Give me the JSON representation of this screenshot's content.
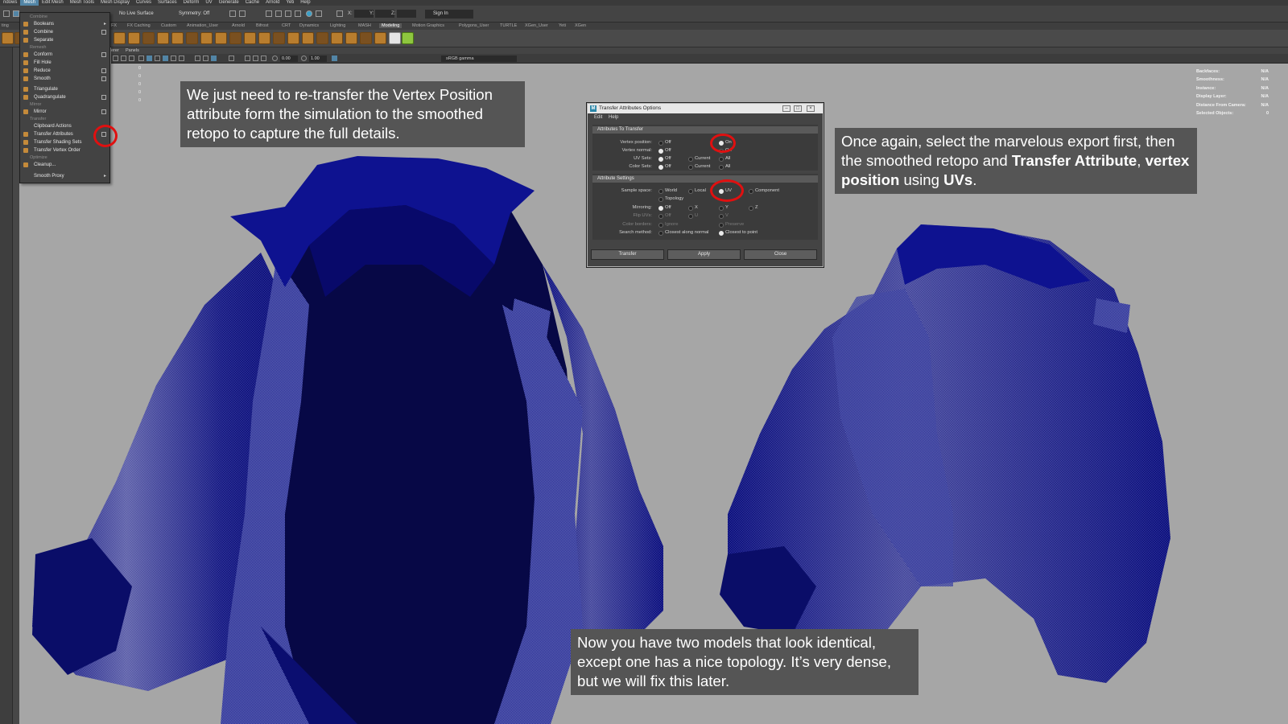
{
  "menubar": {
    "items": [
      "ndows",
      "Mesh",
      "Edit Mesh",
      "Mesh Tools",
      "Mesh Display",
      "Curves",
      "Surfaces",
      "Deform",
      "UV",
      "Generate",
      "Cache",
      "Arnold",
      "Yeti",
      "Help"
    ],
    "active": "Mesh"
  },
  "statusline": {
    "live_surface": "No Live Surface",
    "symmetry": "Symmetry: Off",
    "x_label": "X:",
    "y_label": "Y:",
    "z_label": "Z:",
    "sign_in": "Sign In"
  },
  "shelf_tabs": [
    "ting",
    "FX",
    "FX Caching",
    "Custom",
    "Animation_User",
    "Arnold",
    "Bifrost",
    "CRT",
    "Dynamics",
    "Lighting",
    "MASH",
    "Modeling",
    "Motion Graphics",
    "Polygons_User",
    "TURTLE",
    "XGen_User",
    "Yeti",
    "XGen"
  ],
  "shelf_active_tab": "Modeling",
  "panel_menu": [
    "erer",
    "Panels"
  ],
  "view_toolbar": {
    "exposure": "0.00",
    "gamma_value": "1.00",
    "color_space": "sRGB gamma"
  },
  "viewport_numbers": [
    "0",
    "0",
    "0",
    "0",
    "0"
  ],
  "hud": [
    {
      "label": "Backfaces:",
      "value": "N/A"
    },
    {
      "label": "Smoothness:",
      "value": "N/A"
    },
    {
      "label": "Instance:",
      "value": "N/A"
    },
    {
      "label": "Display Layer:",
      "value": "N/A"
    },
    {
      "label": "Distance From Camera:",
      "value": "N/A"
    },
    {
      "label": "Selected Objects:",
      "value": "0"
    }
  ],
  "mesh_menu": {
    "sections": {
      "combine": "Combine",
      "remesh": "Remesh",
      "mirror": "Mirror",
      "transfer": "Transfer",
      "optimize": "Optimize"
    },
    "items": {
      "booleans": "Booleans",
      "combine": "Combine",
      "separate": "Separate",
      "conform": "Conform",
      "fill_hole": "Fill Hole",
      "reduce": "Reduce",
      "smooth": "Smooth",
      "triangulate": "Triangulate",
      "quadrangulate": "Quadrangulate",
      "mirror": "Mirror",
      "clipboard_actions": "Clipboard Actions",
      "transfer_attributes": "Transfer Attributes",
      "transfer_shading_sets": "Transfer Shading Sets",
      "transfer_vertex_order": "Transfer Vertex Order",
      "cleanup": "Cleanup...",
      "smooth_proxy": "Smooth Proxy"
    }
  },
  "dialog": {
    "title": "Transfer Attributes Options",
    "menu": [
      "Edit",
      "Help"
    ],
    "section_transfer": "Attributes To Transfer",
    "section_settings": "Attribute Settings",
    "vertex_position": {
      "label": "Vertex position:",
      "off": "Off",
      "on": "On"
    },
    "vertex_normal": {
      "label": "Vertex normal:",
      "off": "Off",
      "on": "On"
    },
    "uv_sets": {
      "label": "UV Sets:",
      "off": "Off",
      "current": "Current",
      "all": "All"
    },
    "color_sets": {
      "label": "Color Sets:",
      "off": "Off",
      "current": "Current",
      "all": "All"
    },
    "sample_space": {
      "label": "Sample space:",
      "world": "World",
      "local": "Local",
      "uv": "UV",
      "component": "Component",
      "topology": "Topology"
    },
    "mirroring": {
      "label": "Mirroring:",
      "off": "Off",
      "x": "X",
      "y": "Y",
      "z": "Z"
    },
    "flip_uvs": {
      "label": "Flip UVs:",
      "off": "Off",
      "u": "U",
      "v": "V"
    },
    "color_borders": {
      "label": "Color borders:",
      "ignore": "Ignore",
      "preserve": "Preserve"
    },
    "search_method": {
      "label": "Search method:",
      "closest_normal": "Closest along normal",
      "closest_point": "Closest to point"
    },
    "buttons": {
      "transfer": "Transfer",
      "apply": "Apply",
      "close": "Close"
    }
  },
  "captions": {
    "top_left": "We just need to re-transfer the Vertex Position attribute form the simulation to the smoothed retopo to capture the full details.",
    "top_right_1": "Once again, select the marvelous export first, then the smoothed retopo and ",
    "top_right_bold_1": "Transfer Attribute",
    "top_right_2": ", ",
    "top_right_bold_2": "vertex position",
    "top_right_3": " using ",
    "top_right_bold_3": "UVs",
    "top_right_4": ".",
    "bottom": "Now you have two models that look identical, except one has a nice topology. It’s very dense, but we will fix this later."
  },
  "colors": {
    "mesh_blue": "#0c0f7a",
    "mesh_dark": "#070846",
    "highlight_red": "#e01010",
    "caption_bg": "#555555",
    "viewport_bg": "#a6a6a6"
  }
}
